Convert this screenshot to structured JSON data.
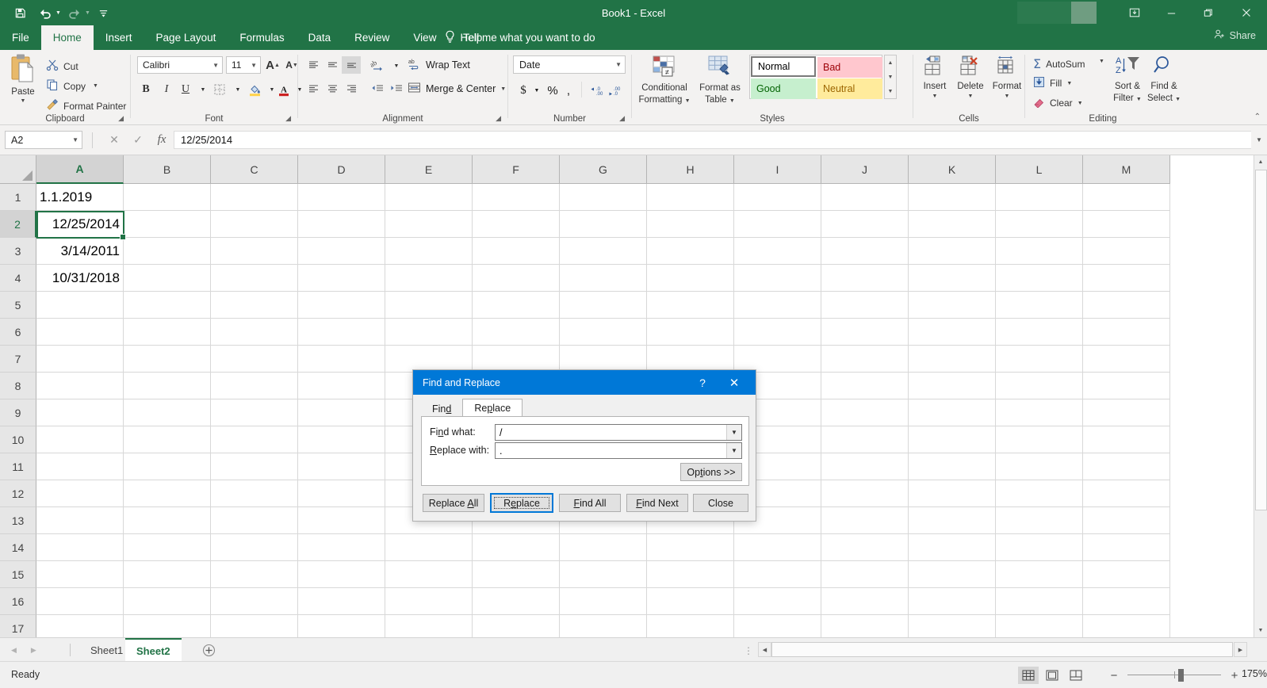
{
  "titlebar": {
    "document_title": "Book1  -  Excel",
    "quick_access": [
      {
        "name": "save",
        "label": "Save"
      },
      {
        "name": "undo",
        "label": "Undo"
      },
      {
        "name": "redo",
        "label": "Redo"
      },
      {
        "name": "customize-qat",
        "label": "Customize Quick Access Toolbar"
      }
    ],
    "window_controls": [
      {
        "name": "ribbon-display-options",
        "glyph": "⬛"
      },
      {
        "name": "minimize",
        "glyph": "–"
      },
      {
        "name": "restore",
        "glyph": "❐"
      },
      {
        "name": "close",
        "glyph": "✕"
      }
    ]
  },
  "ribbon": {
    "tabs": [
      {
        "label": "File",
        "active": false
      },
      {
        "label": "Home",
        "active": true
      },
      {
        "label": "Insert",
        "active": false
      },
      {
        "label": "Page Layout",
        "active": false
      },
      {
        "label": "Formulas",
        "active": false
      },
      {
        "label": "Data",
        "active": false
      },
      {
        "label": "Review",
        "active": false
      },
      {
        "label": "View",
        "active": false
      },
      {
        "label": "Help",
        "active": false
      }
    ],
    "tell_me": "Tell me what you want to do",
    "share": "Share",
    "groups": {
      "clipboard": {
        "label": "Clipboard",
        "paste": "Paste",
        "cut": "Cut",
        "copy": "Copy",
        "format_painter": "Format Painter"
      },
      "font": {
        "label": "Font",
        "font_name": "Calibri",
        "font_size": "11",
        "grow_font": "A",
        "shrink_font": "A",
        "bold": "B",
        "italic": "I",
        "underline": "U"
      },
      "alignment": {
        "label": "Alignment",
        "wrap_text": "Wrap Text",
        "merge_center": "Merge & Center"
      },
      "number": {
        "label": "Number",
        "format": "Date",
        "currency": "$",
        "percent": "%",
        "comma": ","
      },
      "styles": {
        "label": "Styles",
        "conditional_formatting": "Conditional\nFormatting",
        "conditional_formatting_l1": "Conditional",
        "conditional_formatting_l2": "Formatting",
        "format_as_table_l1": "Format as",
        "format_as_table_l2": "Table",
        "cells": [
          {
            "label": "Normal",
            "bg": "#ffffff",
            "fg": "#000000"
          },
          {
            "label": "Bad",
            "bg": "#ffc7ce",
            "fg": "#9c0006"
          },
          {
            "label": "Good",
            "bg": "#c6efce",
            "fg": "#006100"
          },
          {
            "label": "Neutral",
            "bg": "#ffeb9c",
            "fg": "#9c6500"
          }
        ]
      },
      "cells": {
        "label": "Cells",
        "insert": "Insert",
        "delete": "Delete",
        "format": "Format"
      },
      "editing": {
        "label": "Editing",
        "autosum": "AutoSum",
        "fill": "Fill",
        "clear": "Clear",
        "sort_filter_l1": "Sort &",
        "sort_filter_l2": "Filter",
        "find_select_l1": "Find &",
        "find_select_l2": "Select"
      }
    }
  },
  "formula_bar": {
    "name_box": "A2",
    "cancel_icon": "✕",
    "enter_icon": "✓",
    "function_icon": "fx",
    "value": "12/25/2014"
  },
  "grid": {
    "columns": [
      "A",
      "B",
      "C",
      "D",
      "E",
      "F",
      "G",
      "H",
      "I",
      "J",
      "K",
      "L",
      "M"
    ],
    "selected_column": "A",
    "rows": [
      "1",
      "2",
      "3",
      "4",
      "5",
      "6",
      "7",
      "8",
      "9",
      "10",
      "11",
      "12",
      "13",
      "14",
      "15",
      "16",
      "17"
    ],
    "selected_row": "2",
    "selected_cell": "A2",
    "cells": [
      {
        "row": "1",
        "col": "A",
        "value": "1.1.2019",
        "align": "l"
      },
      {
        "row": "2",
        "col": "A",
        "value": "12/25/2014",
        "align": "r"
      },
      {
        "row": "3",
        "col": "A",
        "value": "3/14/2011",
        "align": "r"
      },
      {
        "row": "4",
        "col": "A",
        "value": "10/31/2018",
        "align": "r"
      }
    ]
  },
  "sheet_tabs": {
    "tabs": [
      {
        "label": "Sheet1",
        "active": false
      },
      {
        "label": "Sheet2",
        "active": true
      }
    ],
    "add_sheet": "+"
  },
  "status_bar": {
    "status": "Ready",
    "views": [
      {
        "name": "normal-view",
        "selected": true
      },
      {
        "name": "page-layout-view",
        "selected": false
      },
      {
        "name": "page-break-preview",
        "selected": false
      }
    ],
    "zoom_out": "−",
    "zoom_in": "+",
    "zoom_level": "175%"
  },
  "dialog": {
    "title": "Find and Replace",
    "help_glyph": "?",
    "close_glyph": "✕",
    "tabs": [
      {
        "label": "Find",
        "active": false
      },
      {
        "label": "Replace",
        "active": true
      }
    ],
    "find_what_label": "Find what:",
    "find_what_value": "/",
    "replace_with_label": "Replace with:",
    "replace_with_value": ".",
    "options_button": "Options >>",
    "buttons": [
      {
        "label": "Replace All",
        "focused": false
      },
      {
        "label": "Replace",
        "focused": true
      },
      {
        "label": "Find All",
        "focused": false
      },
      {
        "label": "Find Next",
        "focused": false
      },
      {
        "label": "Close",
        "focused": false
      }
    ]
  }
}
